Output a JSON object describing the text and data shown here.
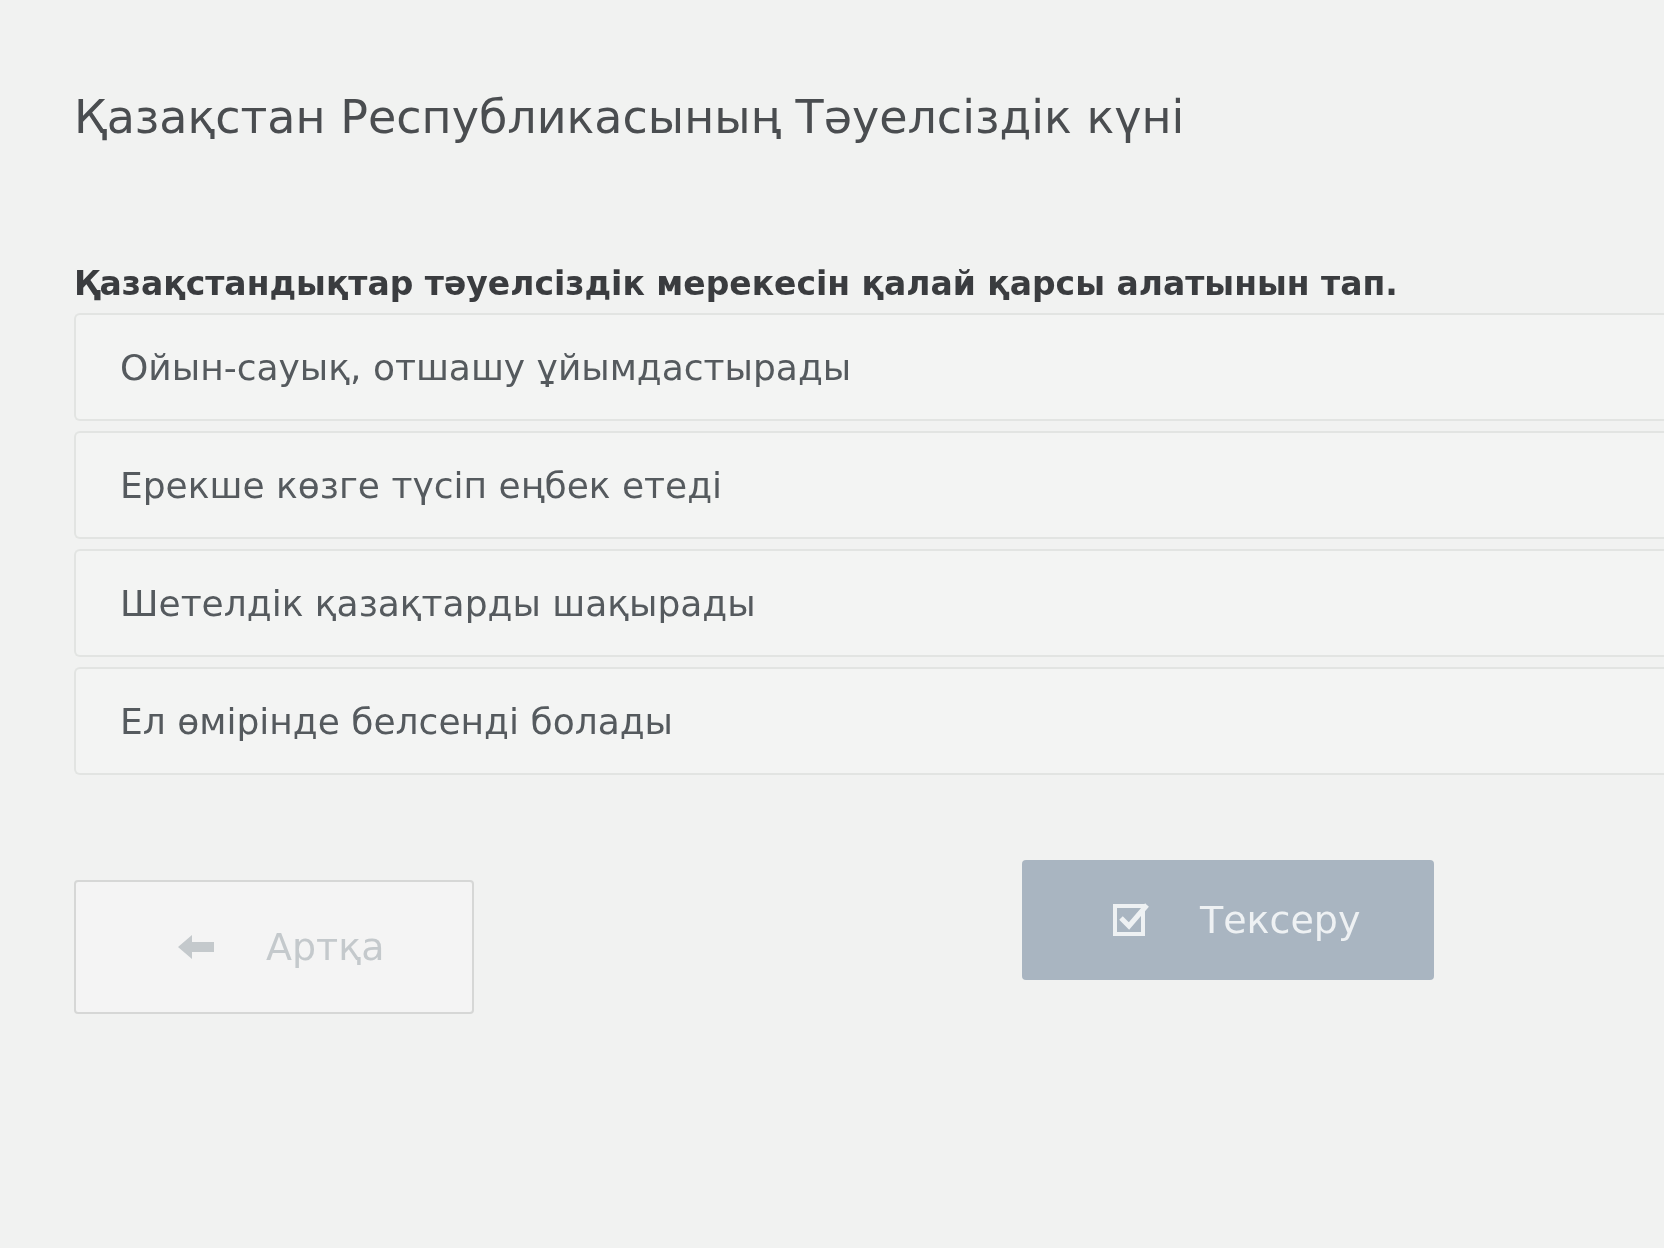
{
  "title": "Қазақстан Республикасының Тәуелсіздік күні",
  "question": "Қазақстандықтар тәуелсіздік мерекесін қалай қарсы алатынын тап.",
  "options": [
    {
      "text": "Ойын-сауық, отшашу ұйымдастырады",
      "selected": false
    },
    {
      "text": "Ерекше көзге түсіп еңбек етеді",
      "selected": false
    },
    {
      "text": "Шетелдік қазақтарды шақырады",
      "selected": false
    },
    {
      "text": "Ел өмірінде белсенді болады",
      "selected": false
    }
  ],
  "back_button": {
    "label": "Артқа",
    "disabled": true
  },
  "check_button": {
    "label": "Тексеру",
    "disabled": true
  }
}
